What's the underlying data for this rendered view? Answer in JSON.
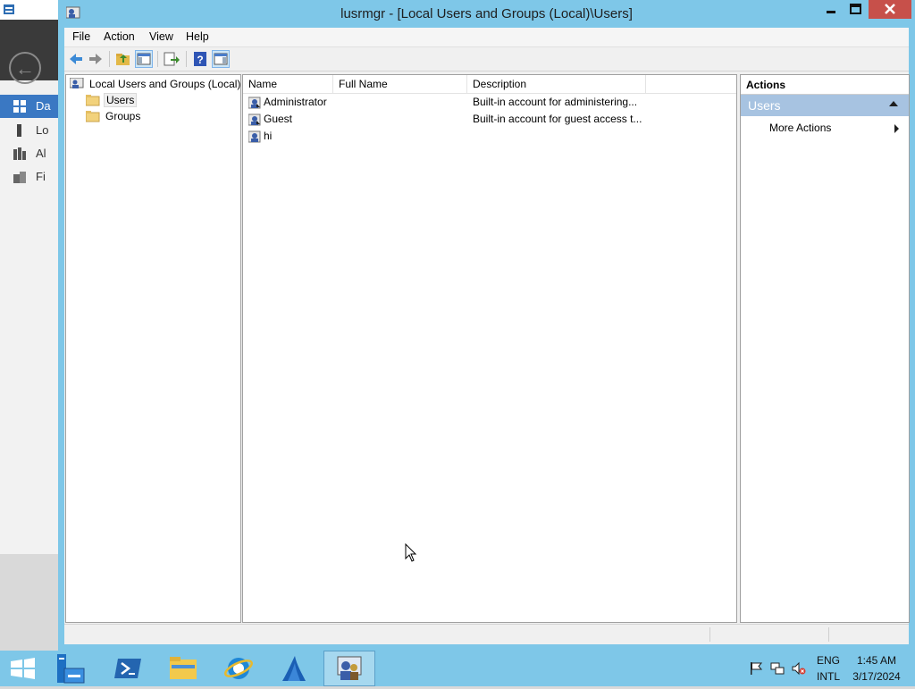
{
  "window": {
    "title": "lusrmgr - [Local Users and Groups (Local)\\Users]"
  },
  "menubar": {
    "items": [
      "File",
      "Action",
      "View",
      "Help"
    ]
  },
  "tree": {
    "root": "Local Users and Groups (Local)",
    "children": [
      "Users",
      "Groups"
    ],
    "selected": "Users"
  },
  "list": {
    "columns": [
      "Name",
      "Full Name",
      "Description"
    ],
    "rows": [
      {
        "name": "Administrator",
        "full_name": "",
        "description": "Built-in account for administering..."
      },
      {
        "name": "Guest",
        "full_name": "",
        "description": "Built-in account for guest access t..."
      },
      {
        "name": "hi",
        "full_name": "",
        "description": ""
      }
    ]
  },
  "actions": {
    "header": "Actions",
    "section": "Users",
    "items": [
      "More Actions"
    ]
  },
  "background_window": {
    "nav_items": [
      "Da",
      "Lo",
      "Al",
      "Fi"
    ]
  },
  "taskbar": {
    "buttons": [
      "start-button",
      "server-manager",
      "powershell",
      "file-explorer",
      "internet-explorer",
      "app-shark",
      "lusrmgr"
    ],
    "active": "lusrmgr",
    "language": "ENG",
    "layout": "INTL",
    "time": "1:45 AM",
    "date": "3/17/2024"
  },
  "colors": {
    "accent": "#7ec7e8",
    "close": "#c7504a",
    "section": "#a7c3e1"
  }
}
